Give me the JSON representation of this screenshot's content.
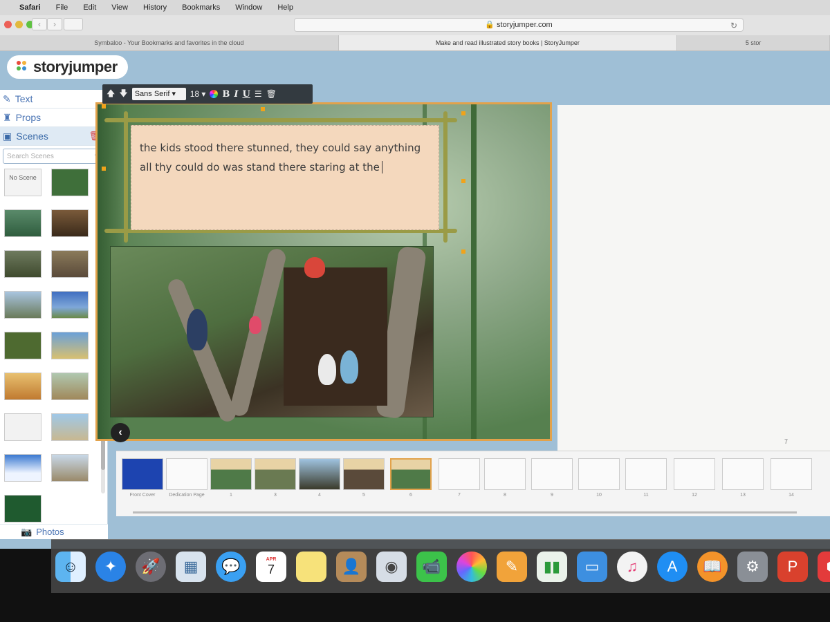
{
  "menubar": {
    "apple": "",
    "items": [
      "Safari",
      "File",
      "Edit",
      "View",
      "History",
      "Bookmarks",
      "Window",
      "Help"
    ]
  },
  "browser": {
    "url": "storyjumper.com",
    "tabs": [
      "Symbaloo - Your Bookmarks and favorites in the cloud",
      "Make and read illustrated story books | StoryJumper",
      "5 stor"
    ]
  },
  "app": {
    "logo": "storyjumper",
    "panel": {
      "text_label": "Text",
      "props_label": "Props",
      "scenes_label": "Scenes",
      "search_placeholder": "Search Scenes",
      "no_scene_label": "No Scene",
      "photos_label": "Photos"
    },
    "format_toolbar": {
      "font": "Sans Serif",
      "size": "18",
      "bold": "B",
      "italic": "I",
      "underline": "U"
    },
    "editor": {
      "text_line1": "the kids stood there stunned, they could say anything",
      "text_line2": "all thy could do was stand there staring at the"
    },
    "right_page_number": "7",
    "filmstrip": [
      {
        "label": "Front Cover"
      },
      {
        "label": "Dedication Page"
      },
      {
        "label": "1"
      },
      {
        "label": "3"
      },
      {
        "label": "4"
      },
      {
        "label": "5"
      },
      {
        "label": "6"
      },
      {
        "label": "7"
      },
      {
        "label": "8"
      },
      {
        "label": "9"
      },
      {
        "label": "10"
      },
      {
        "label": "11"
      },
      {
        "label": "12"
      },
      {
        "label": "13"
      },
      {
        "label": "14"
      }
    ]
  },
  "dock": {
    "calendar_month": "APR",
    "calendar_day": "7",
    "icons": [
      "finder-icon",
      "safari-icon",
      "launchpad-icon",
      "preview-icon",
      "messages-icon",
      "calendar-icon",
      "notes-icon",
      "contacts-icon",
      "photo-booth-icon",
      "facetime-icon",
      "photos-icon",
      "pages-icon",
      "numbers-icon",
      "keynote-icon",
      "itunes-icon",
      "app-store-icon",
      "ibooks-icon",
      "system-preferences-icon",
      "powerpoint-icon",
      "sketchup-icon"
    ]
  }
}
